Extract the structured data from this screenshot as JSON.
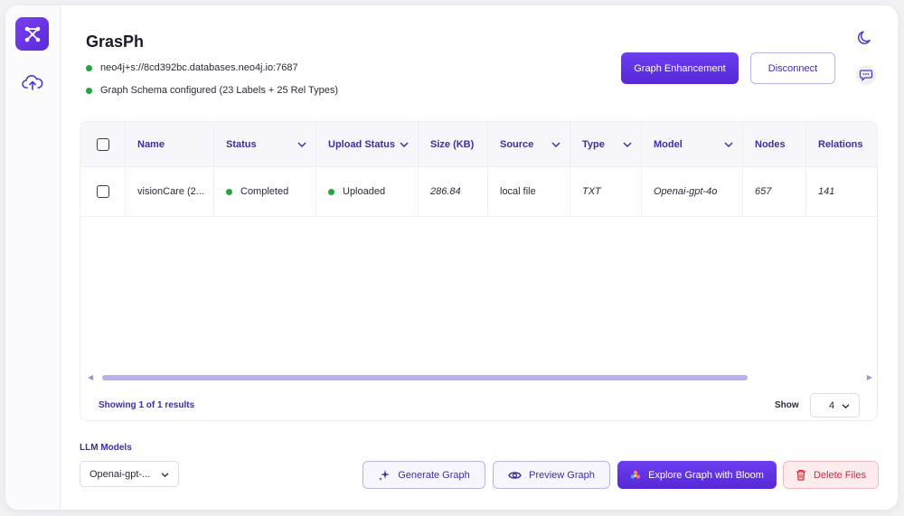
{
  "app": {
    "title": "GrasPh",
    "connection_uri": "neo4j+s://8cd392bc.databases.neo4j.io:7687",
    "schema_status": "Graph Schema configured (23 Labels + 25 Rel Types)",
    "status_color": "#1fa83a",
    "accent_color": "#5a2ad8"
  },
  "sidebar": {
    "items": [
      {
        "icon": "graph-logo-icon"
      },
      {
        "icon": "cloud-upload-icon"
      }
    ]
  },
  "header": {
    "graph_enhancement_label": "Graph Enhancement",
    "disconnect_label": "Disconnect"
  },
  "table": {
    "columns": [
      "Name",
      "Status",
      "Upload Status",
      "Size (KB)",
      "Source",
      "Type",
      "Model",
      "Nodes",
      "Relations"
    ],
    "rows": [
      {
        "name": "visionCare (2...",
        "status": "Completed",
        "upload_status": "Uploaded",
        "size": "286.84",
        "source": "local file",
        "type": "TXT",
        "model": "Openai-gpt-4o",
        "nodes": "657",
        "relations": "141"
      }
    ],
    "footer_text": "Showing 1 of 1 results",
    "show_label": "Show",
    "page_size": "4"
  },
  "bottom": {
    "llm_label": "LLM Models",
    "llm_selected": "Openai-gpt-...",
    "generate_label": "Generate Graph",
    "preview_label": "Preview Graph",
    "explore_label": "Explore Graph with Bloom",
    "delete_label": "Delete Files"
  }
}
